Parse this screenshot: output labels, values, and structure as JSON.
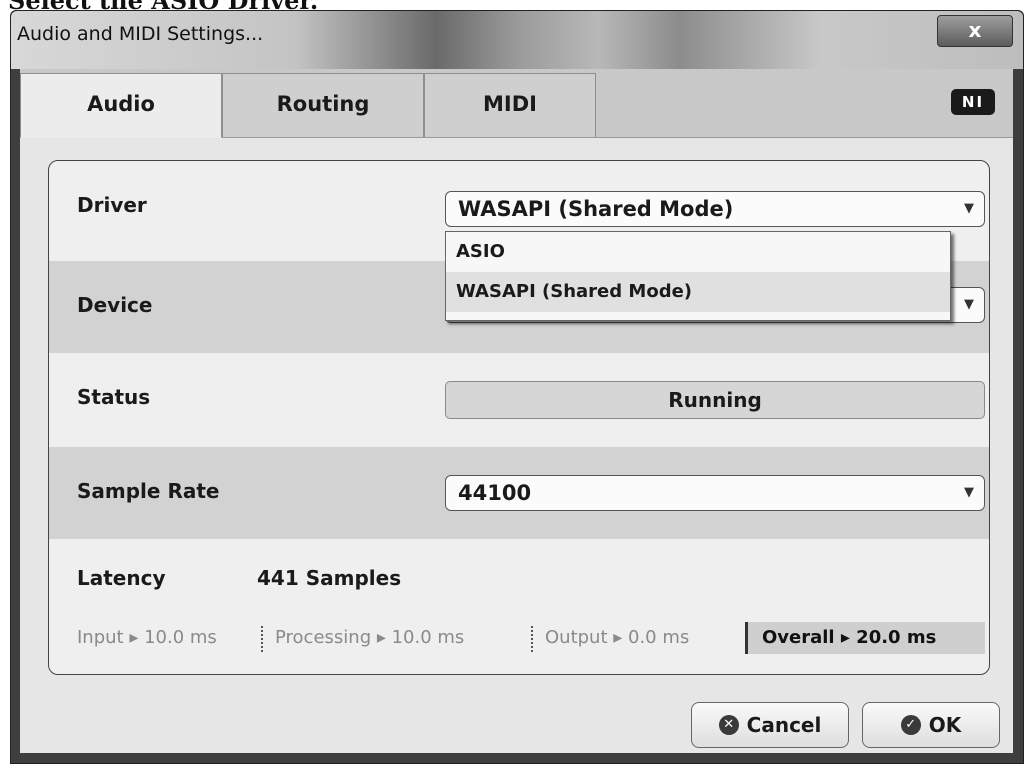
{
  "caption": "Select the ASIO Driver.",
  "window": {
    "title": "Audio and MIDI Settings...",
    "close_label": "x"
  },
  "tabs": [
    {
      "label": "Audio",
      "active": true
    },
    {
      "label": "Routing",
      "active": false
    },
    {
      "label": "MIDI",
      "active": false
    }
  ],
  "logo": "NI",
  "settings": {
    "driver": {
      "label": "Driver",
      "value": "WASAPI (Shared Mode)"
    },
    "driver_options": [
      "ASIO",
      "WASAPI (Shared Mode)"
    ],
    "device": {
      "label": "Device",
      "value": ""
    },
    "status": {
      "label": "Status",
      "value": "Running"
    },
    "sample_rate": {
      "label": "Sample Rate",
      "value": "44100"
    },
    "latency": {
      "label": "Latency",
      "value": "441 Samples"
    }
  },
  "metrics": {
    "input": "Input ▸ 10.0 ms",
    "processing": "Processing ▸ 10.0 ms",
    "output": "Output ▸ 0.0 ms",
    "overall": "Overall ▸ 20.0 ms"
  },
  "buttons": {
    "cancel": "Cancel",
    "ok": "OK"
  },
  "icons": {
    "dropdown_arrow": "chevron-down-icon",
    "cancel": "x-circle-icon",
    "ok": "check-circle-icon"
  }
}
